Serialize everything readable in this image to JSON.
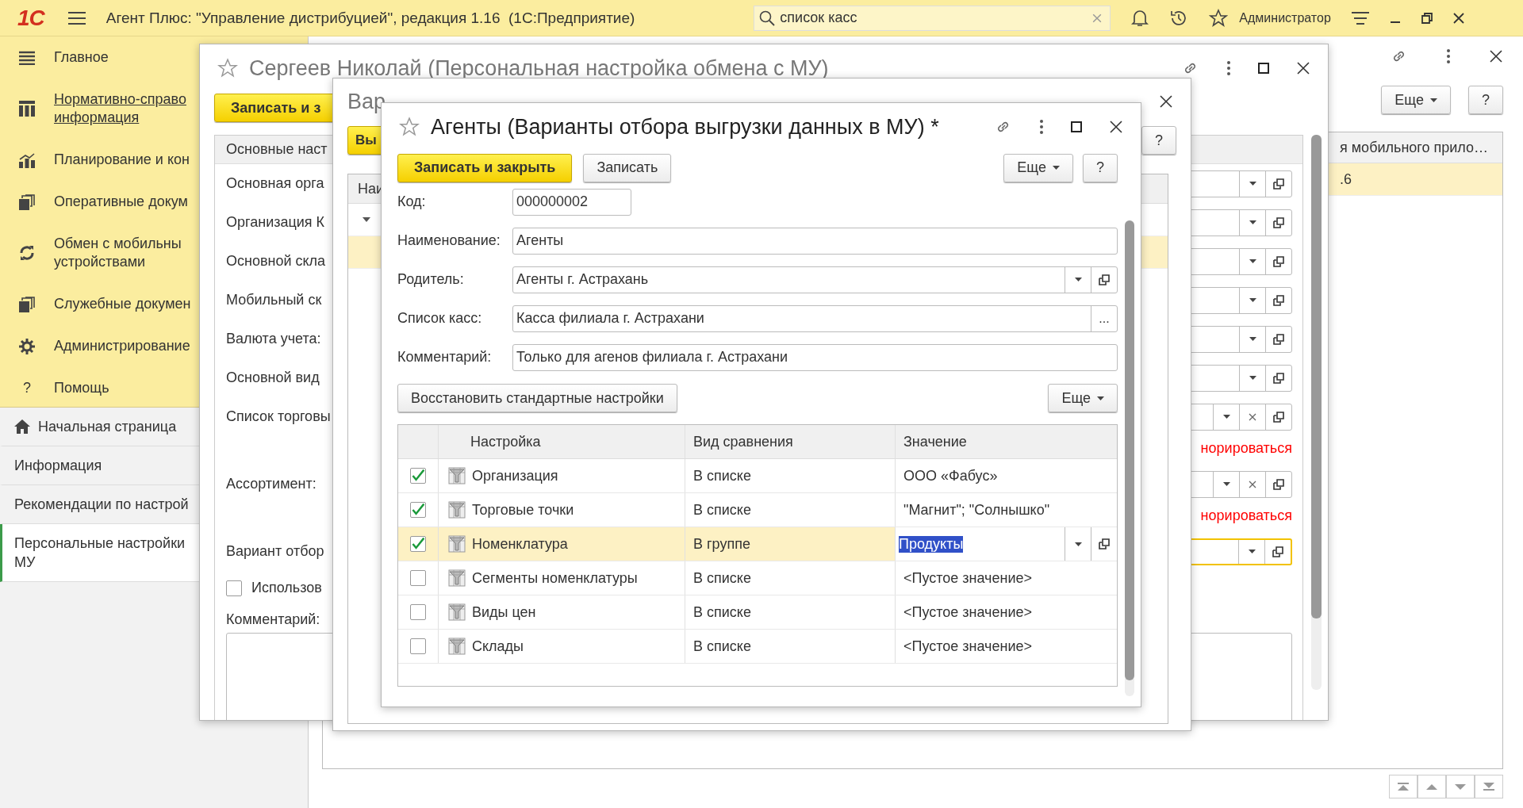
{
  "topbar": {
    "logo": "1С",
    "title": "Агент Плюс: \"Управление дистрибуцией\", редакция 1.16  (1С:Предприятие)",
    "search": {
      "value": "список касс"
    },
    "user": "Администратор"
  },
  "sidebar": {
    "sections": [
      {
        "lines": [
          "Главное"
        ],
        "kind": "lines",
        "link": false
      },
      {
        "lines": [
          "Нормативно-справо",
          "информация"
        ],
        "kind": "grid",
        "link": true
      },
      {
        "lines": [
          "Планирование и кон"
        ],
        "kind": "chart",
        "link": false
      },
      {
        "lines": [
          "Оперативные докум"
        ],
        "kind": "docs",
        "link": false
      },
      {
        "lines": [
          "Обмен с мобильны",
          "устройствами"
        ],
        "kind": "sync",
        "link": false
      },
      {
        "lines": [
          "Служебные докумен"
        ],
        "kind": "docs",
        "link": false
      },
      {
        "lines": [
          "Администрирование"
        ],
        "kind": "gear",
        "link": false
      },
      {
        "lines": [
          "Помощь"
        ],
        "kind": "help",
        "glyph": "?",
        "link": false
      }
    ],
    "pages": [
      {
        "lines": [
          "Начальная страница"
        ],
        "home": true,
        "selected": false
      },
      {
        "lines": [
          "Информация"
        ],
        "home": false,
        "selected": false
      },
      {
        "lines": [
          "Рекомендации по настрой"
        ],
        "home": false,
        "selected": false
      },
      {
        "lines": [
          "Персональные настройки",
          "МУ"
        ],
        "home": false,
        "selected": true
      }
    ]
  },
  "main": {
    "buttons": [
      {
        "label": "Еще",
        "kind": "menu"
      },
      {
        "label": "?",
        "kind": "plain"
      }
    ],
    "column": "я мобильного прило…",
    "cell": ".6"
  },
  "form_person": {
    "title": "Сергеев Николай (Персональная настройка обмена с МУ)",
    "save_button": "Записать и з",
    "tab": "Основные наст",
    "rows": [
      {
        "label": "Основная орга",
        "clear": false,
        "focused": false
      },
      {
        "label": "Организация К",
        "clear": false,
        "focused": false
      },
      {
        "label": "Основной скла",
        "clear": false,
        "focused": false
      },
      {
        "label": "Мобильный ск",
        "clear": false,
        "focused": false
      },
      {
        "label": "Валюта учета:",
        "clear": false,
        "focused": false
      },
      {
        "label": "Основной вид",
        "clear": false,
        "focused": false
      },
      {
        "label": "Список торговы",
        "clear": true,
        "focused": false,
        "warning": "норироваться"
      },
      {
        "label": "Ассортимент:",
        "clear": true,
        "focused": false,
        "warning": "норироваться"
      },
      {
        "label": "Вариант отбор",
        "clear": false,
        "focused": true
      }
    ],
    "use_checkbox": {
      "label": "Использов",
      "checked": false
    },
    "comment_label": "Комментарий:"
  },
  "form_variants": {
    "title": "Вар",
    "button": "Вы",
    "column": "Наи",
    "help": "?"
  },
  "form_agent": {
    "title": "Агенты (Варианты отбора выгрузки данных в МУ) *",
    "buttons": [
      {
        "label": "Записать и закрыть",
        "kind": "primary"
      },
      {
        "label": "Записать",
        "kind": "plain"
      }
    ],
    "more": "Еще",
    "help": "?",
    "fields": [
      {
        "label": "Код:",
        "value": "000000002",
        "kind": "short"
      },
      {
        "label": "Наименование:",
        "value": "Агенты",
        "kind": "text"
      },
      {
        "label": "Родитель:",
        "value": "Агенты г. Астрахань",
        "kind": "select"
      },
      {
        "label": "Список касс:",
        "value": "Касса филиала г. Астрахани",
        "kind": "choice",
        "button": "..."
      },
      {
        "label": "Комментарий:",
        "value": "Только для агенов филиала г. Астрахани",
        "kind": "text"
      }
    ],
    "restore_button": "Восстановить стандартные настройки",
    "table_more": "Еще",
    "columns": [
      "Настройка",
      "Вид сравнения",
      "Значение"
    ],
    "rows": [
      {
        "checked": true,
        "name": "Организация",
        "comparison": "В списке",
        "value": "ООО «Фабус»",
        "selected": false
      },
      {
        "checked": true,
        "name": "Торговые точки",
        "comparison": "В списке",
        "value": "\"Магнит\"; \"Солнышко\"",
        "selected": false
      },
      {
        "checked": true,
        "name": "Номенклатура",
        "comparison": "В группе",
        "value": "Продукты",
        "selected": true
      },
      {
        "checked": false,
        "name": "Сегменты номенклатуры",
        "comparison": "В списке",
        "value": "<Пустое значение>",
        "selected": false
      },
      {
        "checked": false,
        "name": "Виды цен",
        "comparison": "В списке",
        "value": "<Пустое значение>",
        "selected": false
      },
      {
        "checked": false,
        "name": "Склады",
        "comparison": "В списке",
        "value": "<Пустое значение>",
        "selected": false
      }
    ]
  }
}
